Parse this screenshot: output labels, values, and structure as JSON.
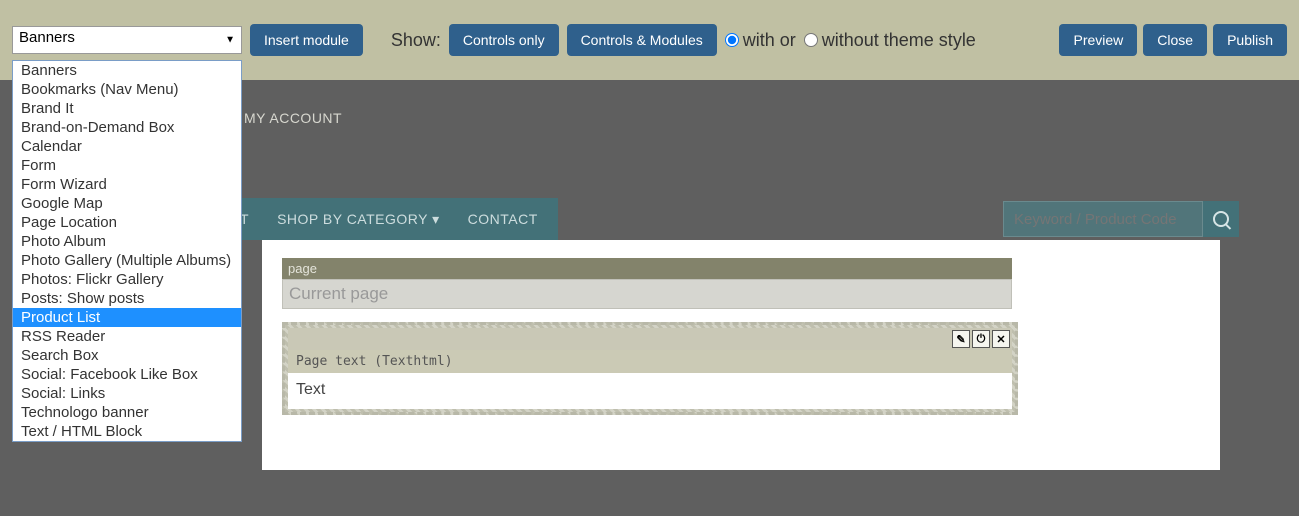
{
  "toolbar": {
    "select_value": "Banners",
    "insert_label": "Insert module",
    "show_label": "Show:",
    "controls_only": "Controls only",
    "controls_modules": "Controls & Modules",
    "with_text": "with or",
    "without_text": "without theme style",
    "preview": "Preview",
    "close": "Close",
    "publish": "Publish"
  },
  "dropdown_items": [
    "Banners",
    "Bookmarks (Nav Menu)",
    "Brand It",
    "Brand-on-Demand Box",
    "Calendar",
    "Form",
    "Form Wizard",
    "Google Map",
    "Page Location",
    "Photo Album",
    "Photo Gallery (Multiple Albums)",
    "Photos: Flickr Gallery",
    "Posts: Show posts",
    "Product List",
    "RSS Reader",
    "Search Box",
    "Social: Facebook Like Box",
    "Social: Links",
    "Technologo banner",
    "Text / HTML Block"
  ],
  "dropdown_highlight_index": 13,
  "account_nav": {
    "my_account": "MY ACCOUNT"
  },
  "nav": {
    "item_partial": "T",
    "shop": "SHOP BY CATEGORY",
    "contact": "CONTACT",
    "search_placeholder": "Keyword / Product Code"
  },
  "page": {
    "header": "page",
    "current": "Current page"
  },
  "module": {
    "title": "Page text (Texthtml)",
    "body": "Text",
    "icons": {
      "edit": "✎",
      "power": "⏻",
      "close": "✕"
    }
  }
}
